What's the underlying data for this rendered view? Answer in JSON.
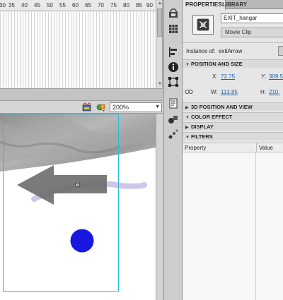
{
  "timeline": {
    "ruler_ticks": [
      "30",
      "35",
      "40",
      "45",
      "50",
      "55",
      "60",
      "65",
      "70",
      "75",
      "80",
      "85",
      "90"
    ]
  },
  "stage_toolbar": {
    "zoom_value": "200%",
    "icons": [
      "edit-scene-icon",
      "edit-symbols-icon"
    ]
  },
  "properties": {
    "tabs": [
      {
        "label": "PROPERTIES",
        "active": true
      },
      {
        "label": "LIBRARY",
        "active": false
      }
    ],
    "instance_name": "EXIT_hangar",
    "symbol_type": "Movie Clip",
    "instance_of_label": "Instance of:",
    "instance_of_value": "exitArrow",
    "sections": {
      "position_and_size": "POSITION AND SIZE",
      "position_3d": "3D POSITION AND VIEW",
      "color_effect": "COLOR EFFECT",
      "display": "DISPLAY",
      "filters": "FILTERS"
    },
    "position": {
      "x_label": "X:",
      "x_value": "72.75",
      "y_label": "Y:",
      "y_value": "309.5",
      "w_label": "W:",
      "w_value": "113.85",
      "h_label": "H:",
      "h_value": "210."
    },
    "filters_table": {
      "columns": [
        "Property",
        "Value"
      ]
    }
  },
  "colors": {
    "accent_link": "#1a64b4",
    "dot": "#1818e0",
    "arrow": "#6f6f6f",
    "selection_box": "#2ab9d6"
  }
}
